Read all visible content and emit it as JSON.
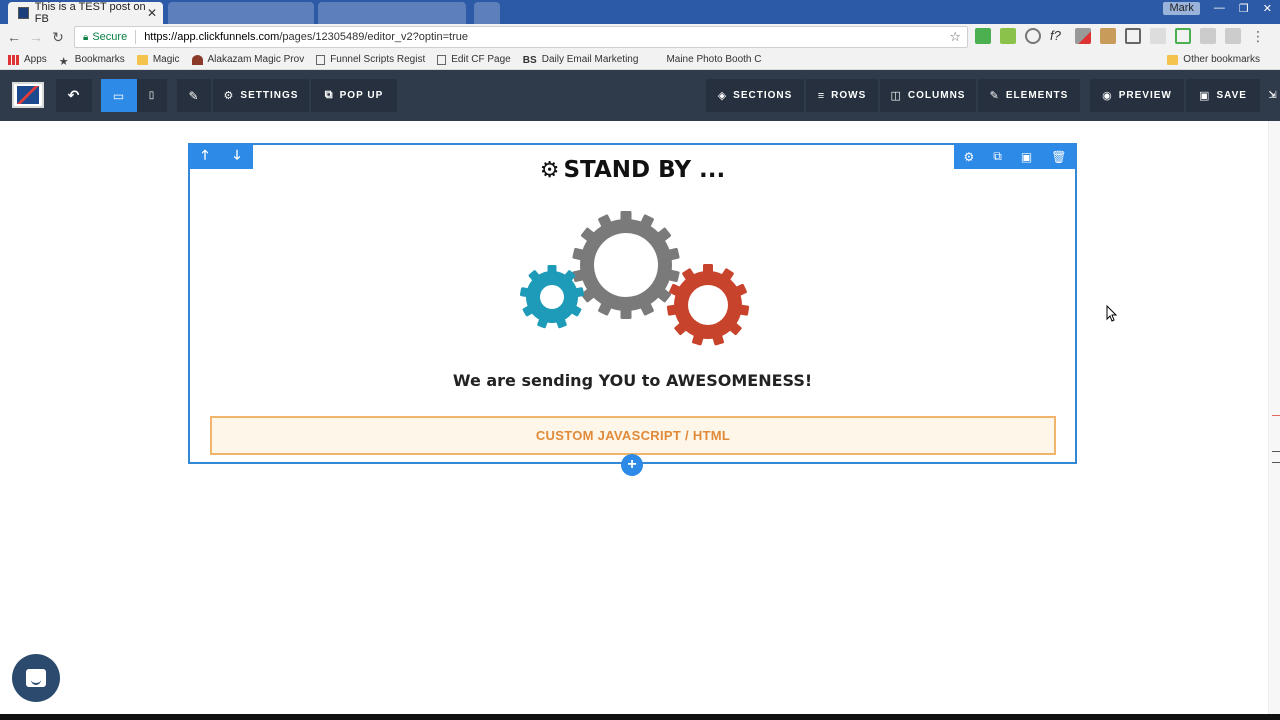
{
  "browser": {
    "active_tab_title": "This is a TEST post on FB",
    "inactive_tabs": [
      "",
      "",
      ""
    ],
    "user_label": "Mark",
    "secure_label": "Secure",
    "url_host": "https://app.clickfunnels.com",
    "url_path": "/pages/12305489/editor_v2?optin=true"
  },
  "bookmarks": [
    {
      "label": "Apps",
      "icon": "apps-grid-icon"
    },
    {
      "label": "Bookmarks",
      "icon": "star-icon"
    },
    {
      "label": "Magic",
      "icon": "folder-icon"
    },
    {
      "label": "Alakazam Magic Prov",
      "icon": "wizard-icon"
    },
    {
      "label": "Funnel Scripts Regist",
      "icon": "page-icon"
    },
    {
      "label": "Edit CF Page",
      "icon": "page-icon"
    },
    {
      "label": "Daily Email Marketing",
      "icon": "bs-icon"
    },
    {
      "label": "Maine Photo Booth C",
      "icon": "blank-icon"
    }
  ],
  "other_bookmarks": "Other bookmarks",
  "toolbar": {
    "settings": "SETTINGS",
    "popup": "POP UP",
    "sections": "SECTIONS",
    "rows": "ROWS",
    "columns": "COLUMNS",
    "elements": "ELEMENTS",
    "preview": "PREVIEW",
    "save": "SAVE"
  },
  "page": {
    "headline": "STAND BY ...",
    "subhead": "We are sending YOU to AWESOMENESS!",
    "custom_element": "CUSTOM JAVASCRIPT / HTML"
  },
  "colors": {
    "toolbar_bg": "#2f3a4b",
    "accent_blue": "#2d8ae6",
    "gear_teal": "#1e9bb8",
    "gear_gray": "#7a7a7a",
    "gear_red": "#c8432b",
    "custom_orange": "#e08a3a"
  }
}
